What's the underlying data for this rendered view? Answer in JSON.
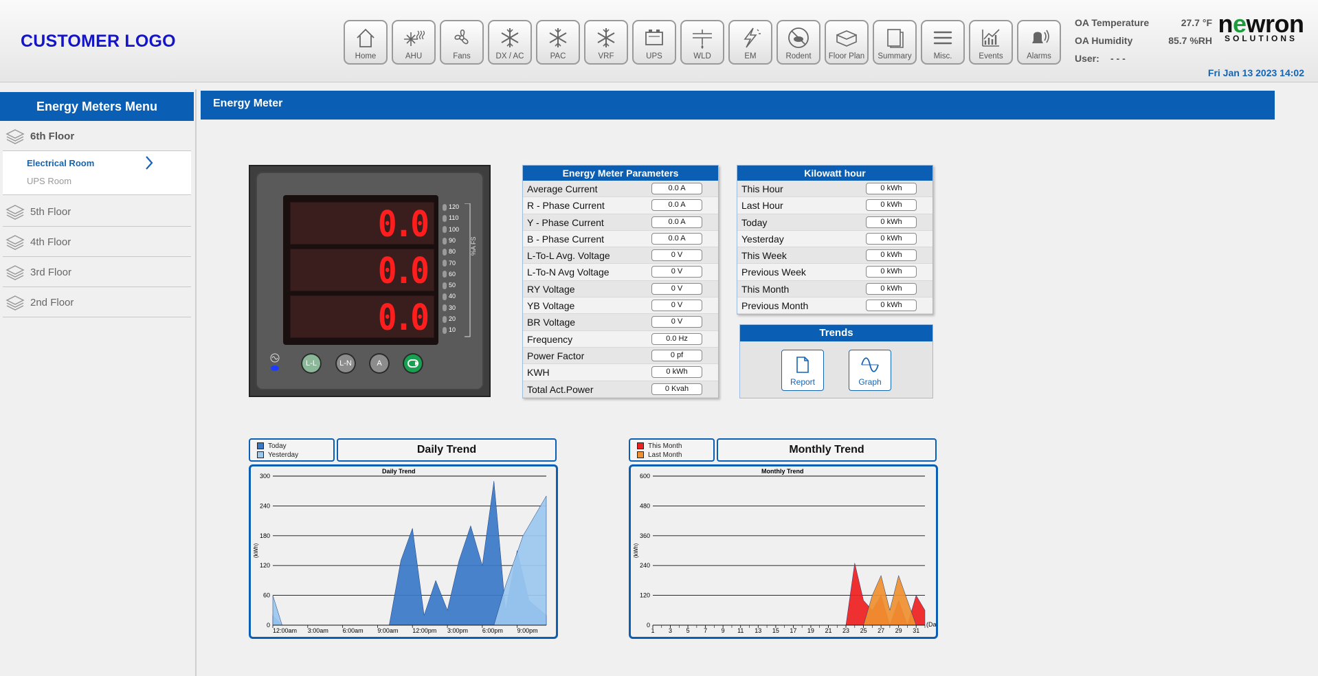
{
  "header": {
    "customer_logo": "CUSTOMER LOGO",
    "brand_main": "newron",
    "brand_sub": "SOLUTIONS",
    "datetime": "Fri Jan 13 2023 14:02",
    "oa_temperature_label": "OA Temperature",
    "oa_temperature_value": "27.7 °F",
    "oa_humidity_label": "OA Humidity",
    "oa_humidity_value": "85.7 %RH",
    "user_label": "User:",
    "user_value": "- - -",
    "nav": [
      {
        "label": "Home",
        "icon": "home-icon"
      },
      {
        "label": "AHU",
        "icon": "ahu-icon"
      },
      {
        "label": "Fans",
        "icon": "fan-icon"
      },
      {
        "label": "DX / AC",
        "icon": "snowflake-icon"
      },
      {
        "label": "PAC",
        "icon": "snowflake-icon"
      },
      {
        "label": "VRF",
        "icon": "snowflake-icon"
      },
      {
        "label": "UPS",
        "icon": "battery-icon"
      },
      {
        "label": "WLD",
        "icon": "water-leak-icon"
      },
      {
        "label": "EM",
        "icon": "lightning-icon"
      },
      {
        "label": "Rodent",
        "icon": "rodent-icon"
      },
      {
        "label": "Floor Plan",
        "icon": "floor-plan-icon"
      },
      {
        "label": "Summary",
        "icon": "summary-icon"
      },
      {
        "label": "Misc.",
        "icon": "menu-lines-icon"
      },
      {
        "label": "Events",
        "icon": "events-chart-icon"
      },
      {
        "label": "Alarms",
        "icon": "bell-icon"
      }
    ]
  },
  "sidebar": {
    "title": "Energy Meters Menu",
    "floors": [
      "6th Floor",
      "5th Floor",
      "4th Floor",
      "3rd Floor",
      "2nd Floor"
    ],
    "rooms": [
      "Electrical Room",
      "UPS Room"
    ]
  },
  "main": {
    "title": "Energy Meter"
  },
  "meter": {
    "readings": [
      "0.0",
      "0.0",
      "0.0"
    ],
    "scale": [
      "120",
      "110",
      "100",
      "90",
      "80",
      "70",
      "60",
      "50",
      "40",
      "30",
      "20",
      "10"
    ],
    "scale_label": "%A FS",
    "buttons": [
      "L-L",
      "L-N",
      "A"
    ]
  },
  "parameters": {
    "title": "Energy Meter Parameters",
    "rows": [
      {
        "label": "Average Current",
        "value": "0.0 A"
      },
      {
        "label": "R - Phase Current",
        "value": "0.0 A"
      },
      {
        "label": "Y - Phase Current",
        "value": "0.0 A"
      },
      {
        "label": "B - Phase Current",
        "value": "0.0 A"
      },
      {
        "label": "L-To-L Avg. Voltage",
        "value": "0 V"
      },
      {
        "label": "L-To-N Avg Voltage",
        "value": "0 V"
      },
      {
        "label": "RY Voltage",
        "value": "0 V"
      },
      {
        "label": "YB Voltage",
        "value": "0 V"
      },
      {
        "label": "BR Voltage",
        "value": "0 V"
      },
      {
        "label": "Frequency",
        "value": "0.0 Hz"
      },
      {
        "label": "Power Factor",
        "value": "0 pf"
      },
      {
        "label": "KWH",
        "value": "0 kWh"
      },
      {
        "label": "Total Act.Power",
        "value": "0 Kvah"
      }
    ]
  },
  "kwh": {
    "title": "Kilowatt hour",
    "rows": [
      {
        "label": "This Hour",
        "value": "0 kWh"
      },
      {
        "label": "Last Hour",
        "value": "0 kWh"
      },
      {
        "label": "Today",
        "value": "0 kWh"
      },
      {
        "label": "Yesterday",
        "value": "0 kWh"
      },
      {
        "label": "This Week",
        "value": "0 kWh"
      },
      {
        "label": "Previous Week",
        "value": "0 kWh"
      },
      {
        "label": "This Month",
        "value": "0 kWh"
      },
      {
        "label": "Previous Month",
        "value": "0 kWh"
      }
    ]
  },
  "trends": {
    "title": "Trends",
    "report_label": "Report",
    "graph_label": "Graph"
  },
  "chart_data": [
    {
      "type": "area",
      "box_title": "Daily Trend",
      "title": "Daily Trend",
      "ylabel": "(kWh)",
      "ylim": [
        0,
        300
      ],
      "yticks": [
        "0",
        "60",
        "120",
        "180",
        "240",
        "300"
      ],
      "xticks": [
        "12:00am",
        "3:00am",
        "6:00am",
        "9:00am",
        "12:00pm",
        "3:00pm",
        "6:00pm",
        "9:00pm"
      ],
      "xlim": [
        0,
        23.5
      ],
      "colors": {
        "Today": "#3a78c8",
        "Yesterday": "#9cc8f0"
      },
      "series": [
        {
          "name": "Today",
          "points": [
            [
              0,
              20
            ],
            [
              0.8,
              0
            ],
            [
              10,
              0
            ],
            [
              11,
              130
            ],
            [
              12,
              195
            ],
            [
              13,
              20
            ],
            [
              14,
              90
            ],
            [
              15,
              30
            ],
            [
              16,
              130
            ],
            [
              17,
              200
            ],
            [
              18,
              120
            ],
            [
              19,
              290
            ],
            [
              20,
              30
            ],
            [
              21,
              150
            ],
            [
              22,
              50
            ],
            [
              23.5,
              20
            ]
          ]
        },
        {
          "name": "Yesterday",
          "points": [
            [
              0,
              60
            ],
            [
              0.8,
              0
            ],
            [
              19,
              0
            ],
            [
              20,
              80
            ],
            [
              21.5,
              180
            ],
            [
              23.5,
              260
            ]
          ]
        }
      ]
    },
    {
      "type": "area",
      "box_title": "Monthly Trend",
      "title": "Monthly Trend",
      "ylabel": "(kWh)",
      "xlabel": "(Day)",
      "ylim": [
        0,
        600
      ],
      "yticks": [
        "0",
        "120",
        "240",
        "360",
        "480",
        "600"
      ],
      "xticks": [
        "1",
        "3",
        "5",
        "7",
        "9",
        "11",
        "13",
        "15",
        "17",
        "19",
        "21",
        "23",
        "25",
        "27",
        "29",
        "31"
      ],
      "xlim": [
        1,
        32
      ],
      "colors": {
        "This Month": "#ee2020",
        "Last Month": "#f09030"
      },
      "series": [
        {
          "name": "This Month",
          "points": [
            [
              1,
              0
            ],
            [
              23,
              0
            ],
            [
              24,
              250
            ],
            [
              25,
              100
            ],
            [
              26,
              60
            ],
            [
              27,
              120
            ],
            [
              28,
              0
            ],
            [
              29,
              100
            ],
            [
              30,
              0
            ],
            [
              31,
              120
            ],
            [
              32,
              60
            ],
            [
              32,
              0
            ]
          ]
        },
        {
          "name": "Last Month",
          "points": [
            [
              1,
              0
            ],
            [
              25,
              0
            ],
            [
              26,
              120
            ],
            [
              27,
              200
            ],
            [
              28,
              60
            ],
            [
              29,
              200
            ],
            [
              30,
              100
            ],
            [
              31,
              0
            ],
            [
              32,
              0
            ]
          ]
        }
      ]
    }
  ]
}
